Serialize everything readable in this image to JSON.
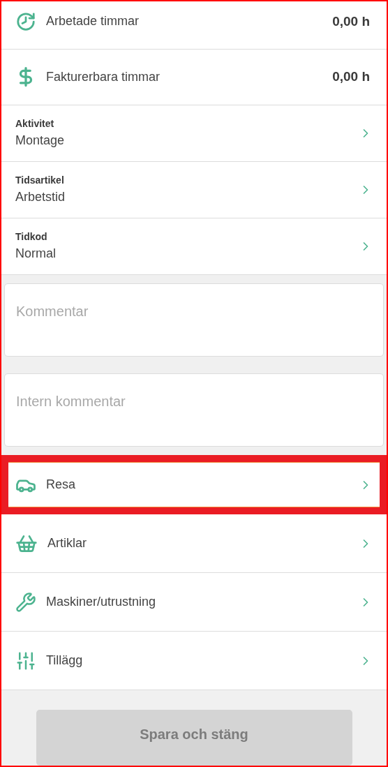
{
  "totals": [
    {
      "label": "Arbetade timmar",
      "value": "0,00 h"
    },
    {
      "label": "Fakturerbara timmar",
      "value": "0,00 h"
    }
  ],
  "pickers": [
    {
      "label": "Aktivitet",
      "value": "Montage"
    },
    {
      "label": "Tidsartikel",
      "value": "Arbetstid"
    },
    {
      "label": "Tidkod",
      "value": "Normal"
    }
  ],
  "comment_fields": [
    {
      "placeholder": "Kommentar"
    },
    {
      "placeholder": "Intern kommentar"
    }
  ],
  "links": [
    {
      "label": "Resa",
      "highlighted": true
    },
    {
      "label": "Artiklar",
      "highlighted": false
    },
    {
      "label": "Maskiner/utrustning",
      "highlighted": false
    },
    {
      "label": "Tillägg",
      "highlighted": false
    }
  ],
  "save_button": {
    "label": "Spara och stäng",
    "disabled": true
  }
}
